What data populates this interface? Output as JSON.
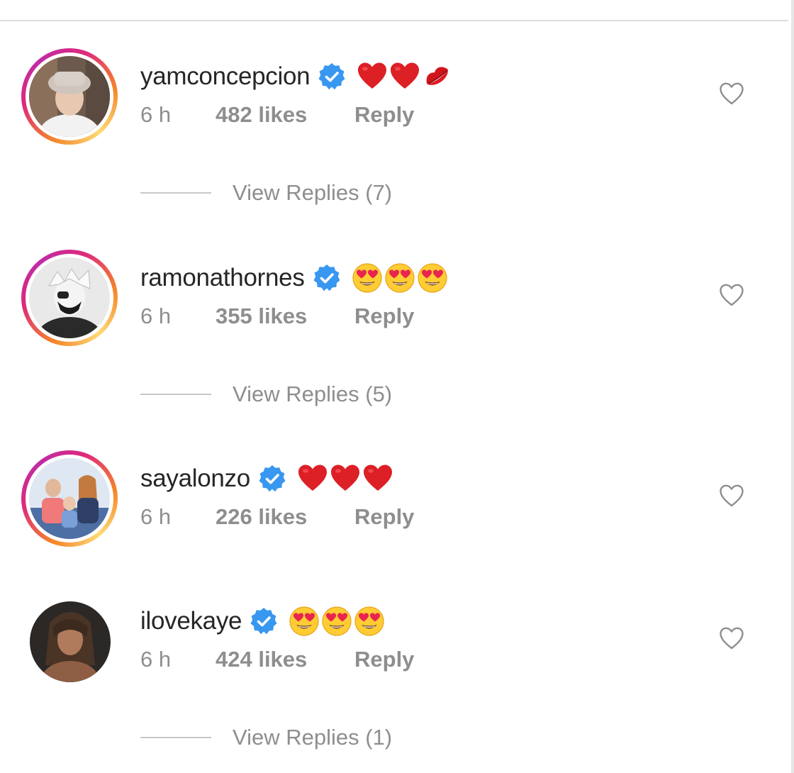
{
  "comments": [
    {
      "username": "yamconcepcion",
      "emojis": [
        "red-heart",
        "red-heart",
        "kiss-mark"
      ],
      "time": "6 h",
      "likes": "482 likes",
      "reply": "Reply",
      "has_story_ring": true,
      "view_replies": "View Replies (7)"
    },
    {
      "username": "ramonathornes",
      "emojis": [
        "heart-eyes",
        "heart-eyes",
        "heart-eyes"
      ],
      "time": "6 h",
      "likes": "355 likes",
      "reply": "Reply",
      "has_story_ring": true,
      "view_replies": "View Replies (5)"
    },
    {
      "username": "sayalonzo",
      "emojis": [
        "red-heart",
        "red-heart",
        "red-heart"
      ],
      "time": "6 h",
      "likes": "226 likes",
      "reply": "Reply",
      "has_story_ring": true
    },
    {
      "username": "ilovekaye",
      "emojis": [
        "heart-eyes",
        "heart-eyes",
        "heart-eyes"
      ],
      "time": "6 h",
      "likes": "424 likes",
      "reply": "Reply",
      "has_story_ring": false,
      "view_replies": "View Replies (1)"
    }
  ],
  "colors": {
    "verified_badge": "#3897f0",
    "text_primary": "#262626",
    "text_secondary": "#8e8e8e",
    "heart_red": "#dd1f26"
  }
}
